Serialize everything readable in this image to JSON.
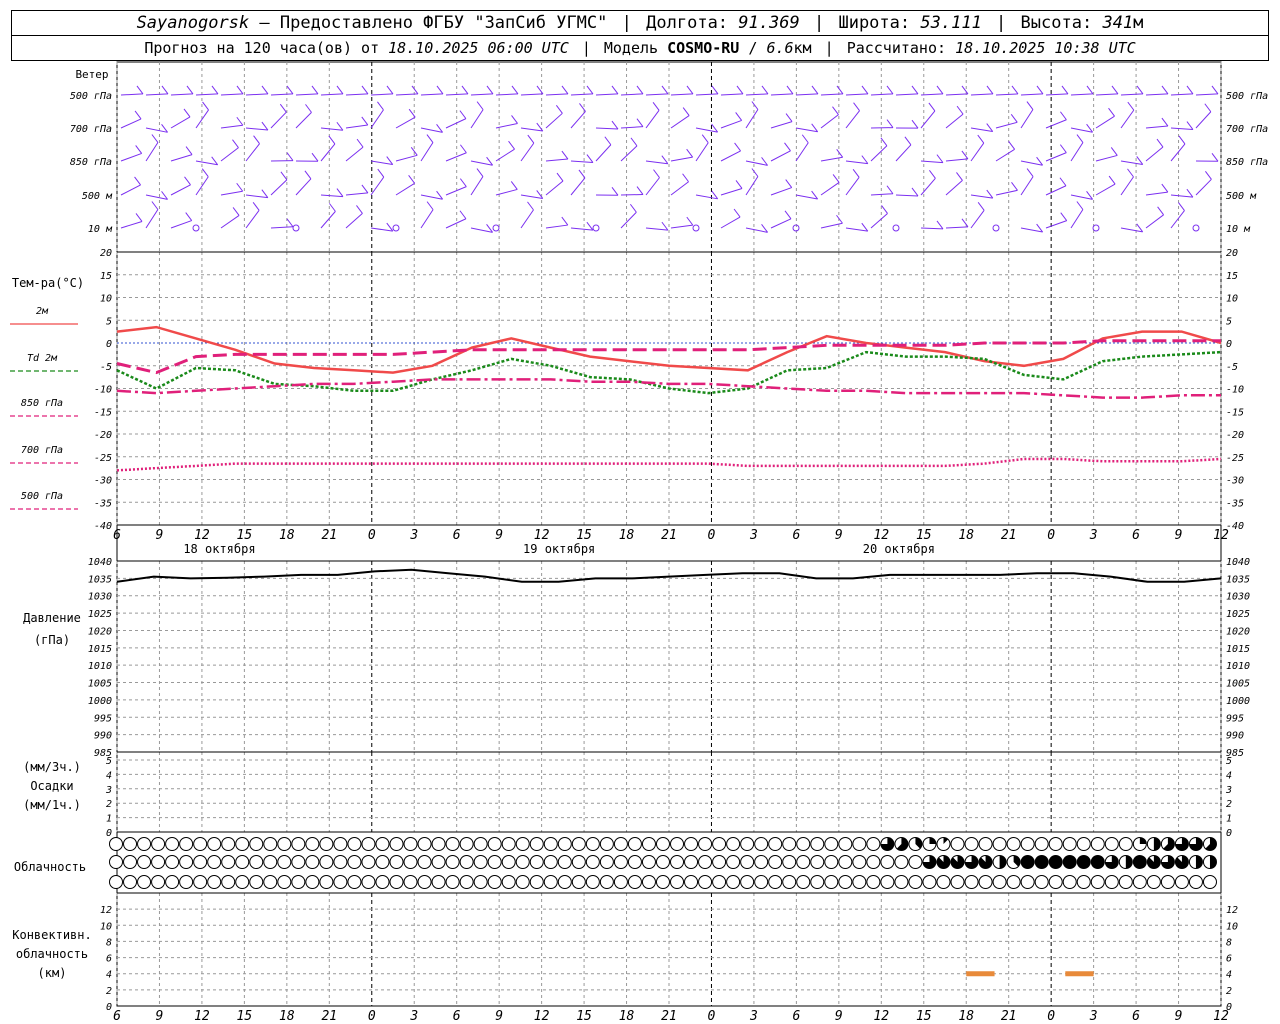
{
  "header": {
    "station": "Sayanogorsk",
    "provider": "— Предоставлено ФГБУ \"ЗапСиб УГМС\"",
    "lon_label": "Долгота:",
    "lon_value": "91.369",
    "lat_label": "Широта:",
    "lat_value": "53.111",
    "alt_label": "Высота:",
    "alt_value": "341",
    "alt_unit": "м",
    "forecast_label": "Прогноз на 120 часа(ов) от",
    "forecast_from": "18.10.2025 06:00 UTC",
    "model_label": "Модель",
    "model_name": "COSMO-RU",
    "model_res": "6.6",
    "model_res_unit": "км",
    "computed_label": "Рассчитано:",
    "computed_at": "18.10.2025 10:38 UTC"
  },
  "time_axis": {
    "tick_labels": [
      "6",
      "9",
      "12",
      "15",
      "18",
      "21",
      "0",
      "3",
      "6",
      "9",
      "12",
      "15",
      "18",
      "21",
      "0",
      "3",
      "6",
      "9",
      "12",
      "15",
      "18",
      "21",
      "0",
      "3",
      "6",
      "9",
      "12"
    ],
    "date_labels": [
      "18 октября",
      "19 октября",
      "20 октября"
    ]
  },
  "wind_panel": {
    "title": "Ветер",
    "levels": [
      "500 гПа",
      "700 гПа",
      "850 гПа",
      "500 м",
      "10 м"
    ],
    "barb_color": "#7b2ff0"
  },
  "chart_data": [
    {
      "type": "line",
      "id": "temperature",
      "ylabel": "Тем-ра(°С)",
      "ylim": [
        -40,
        20
      ],
      "y_ticks": [
        20,
        15,
        10,
        5,
        0,
        -5,
        -10,
        -15,
        -20,
        -25,
        -30,
        -35,
        -40
      ],
      "x_hours": [
        0,
        3,
        6,
        9,
        12,
        15,
        18,
        21,
        24,
        27,
        30,
        33,
        36,
        39,
        42,
        45,
        48,
        51,
        54,
        57,
        60,
        63,
        66,
        69,
        72,
        75,
        78
      ],
      "grid": true,
      "series": [
        {
          "name": "2м",
          "color": "#f04a4a",
          "style": "solid",
          "values": [
            2.5,
            3.5,
            1,
            -1.5,
            -4.5,
            -5.5,
            -6,
            -6.5,
            -5,
            -1,
            1,
            -1,
            -3,
            -4,
            -5,
            -5.5,
            -6,
            -2,
            1.5,
            0,
            -1,
            -2,
            -4,
            -5,
            -3.5,
            1,
            2.5,
            2.5,
            0
          ]
        },
        {
          "name": "Td  2м",
          "color": "#1a8a1a",
          "style": "dot",
          "values": [
            -6,
            -10,
            -5.5,
            -6,
            -9,
            -9.5,
            -10.5,
            -10.5,
            -8,
            -6,
            -3.5,
            -5,
            -7.5,
            -8,
            -10,
            -11,
            -10,
            -6,
            -5.5,
            -2,
            -3,
            -3,
            -3.5,
            -7,
            -8,
            -4,
            -3,
            -2.5,
            -2
          ]
        },
        {
          "name": "850 гПа",
          "color": "#e0207a",
          "style": "longdash",
          "values": [
            -4.5,
            -6.5,
            -3,
            -2.5,
            -2.5,
            -2.5,
            -2.5,
            -2.5,
            -2,
            -1.5,
            -1.5,
            -1.5,
            -1.5,
            -1.5,
            -1.5,
            -1.5,
            -1.5,
            -1,
            -0.5,
            -0.5,
            -0.5,
            -0.5,
            0,
            0,
            0,
            0.5,
            0.5,
            0.5,
            0.5
          ]
        },
        {
          "name": "700 гПа",
          "color": "#e0207a",
          "style": "dashdot",
          "values": [
            -10.5,
            -11,
            -10.5,
            -10,
            -9.5,
            -9,
            -9,
            -8.5,
            -8,
            -8,
            -8,
            -8,
            -8.5,
            -8.5,
            -9,
            -9,
            -9.5,
            -10,
            -10.5,
            -10.5,
            -11,
            -11,
            -11,
            -11,
            -11.5,
            -12,
            -12,
            -11.5,
            -11.5
          ]
        },
        {
          "name": "500 гПа",
          "color": "#e0207a",
          "style": "fine",
          "values": [
            -28,
            -27.5,
            -27,
            -26.5,
            -26.5,
            -26.5,
            -26.5,
            -26.5,
            -26.5,
            -26.5,
            -26.5,
            -26.5,
            -26.5,
            -26.5,
            -26.5,
            -26.5,
            -27,
            -27,
            -27,
            -27,
            -27,
            -27,
            -26.5,
            -25.5,
            -25.5,
            -26,
            -26,
            -26,
            -25.5
          ]
        }
      ]
    },
    {
      "type": "line",
      "id": "pressure",
      "ylabel": "Давление",
      "ylabel2": "(гПа)",
      "ylim": [
        985,
        1040
      ],
      "y_ticks": [
        1040,
        1035,
        1030,
        1025,
        1020,
        1015,
        1010,
        1005,
        1000,
        995,
        990,
        985
      ],
      "grid": true,
      "series": [
        {
          "name": "",
          "color": "#000000",
          "style": "solid",
          "values": [
            1034,
            1035.5,
            1035,
            1035.2,
            1035.5,
            1036,
            1036,
            1037,
            1037.5,
            1036.5,
            1035.5,
            1034,
            1034,
            1035,
            1035,
            1035.5,
            1036,
            1036.5,
            1036.5,
            1035,
            1035,
            1036,
            1036,
            1036,
            1036,
            1036.5,
            1036.5,
            1035.5,
            1034,
            1034,
            1035
          ]
        }
      ]
    },
    {
      "type": "bar",
      "id": "precipitation",
      "ylabel": "(мм/3ч.)",
      "ylabel2": "Осадки",
      "ylabel3": "(мм/1ч.)",
      "ylim": [
        0,
        5
      ],
      "y_ticks": [
        5,
        4,
        3,
        2,
        1,
        0
      ],
      "values": []
    },
    {
      "type": "table",
      "id": "cloudiness",
      "ylabel": "Облачность",
      "rows": [
        {
          "level": "high",
          "octas": [
            0,
            0,
            0,
            0,
            0,
            0,
            0,
            0,
            0,
            0,
            0,
            0,
            0,
            0,
            0,
            0,
            0,
            0,
            0,
            0,
            0,
            0,
            0,
            0,
            0,
            0,
            0,
            0,
            0,
            0,
            0,
            0,
            0,
            0,
            0,
            0,
            0,
            0,
            0,
            0,
            0,
            0,
            0,
            0,
            0,
            0,
            0,
            0,
            0,
            0,
            0,
            0,
            0,
            0,
            0,
            0,
            0,
            0,
            0,
            0,
            0,
            0,
            0,
            0,
            0,
            0,
            0,
            0,
            0,
            0,
            0,
            0,
            0,
            0,
            0,
            0,
            0,
            0,
            0,
            0,
            0,
            0,
            0,
            0,
            0,
            0,
            0,
            0,
            0,
            0,
            0,
            0,
            0,
            0,
            0,
            0,
            0,
            0,
            0,
            0,
            0,
            0,
            4,
            6,
            3,
            5,
            2,
            3,
            1,
            2,
            1,
            0,
            0,
            0,
            0,
            0,
            0,
            0,
            0,
            0,
            0,
            0,
            0,
            0,
            0,
            0,
            0,
            0,
            0,
            0,
            0,
            0,
            0,
            0,
            0,
            0,
            1,
            2,
            3,
            4,
            5,
            6,
            6,
            7,
            6,
            6,
            5
          ]
        },
        {
          "level": "mid",
          "octas": [
            0,
            0,
            0,
            0,
            0,
            0,
            0,
            0,
            0,
            0,
            0,
            0,
            0,
            0,
            0,
            0,
            0,
            0,
            0,
            0,
            0,
            0,
            0,
            0,
            0,
            0,
            0,
            0,
            0,
            0,
            0,
            0,
            0,
            0,
            0,
            0,
            0,
            0,
            0,
            0,
            0,
            0,
            0,
            0,
            0,
            0,
            0,
            0,
            0,
            0,
            0,
            0,
            0,
            0,
            0,
            0,
            0,
            0,
            0,
            0,
            0,
            0,
            0,
            0,
            0,
            0,
            0,
            0,
            0,
            0,
            0,
            0,
            0,
            0,
            0,
            0,
            0,
            0,
            0,
            0,
            0,
            0,
            0,
            0,
            0,
            0,
            0,
            0,
            0,
            0,
            0,
            0,
            0,
            0,
            0,
            0,
            0,
            0,
            0,
            0,
            0,
            0,
            6,
            7,
            7,
            7,
            4,
            6,
            6,
            7,
            7,
            4,
            3,
            5,
            8,
            8,
            8,
            8,
            8,
            8,
            8,
            8,
            8,
            8,
            8,
            6,
            4,
            5,
            8,
            6,
            7,
            4,
            6,
            7,
            8,
            4,
            4,
            4
          ]
        },
        {
          "level": "low",
          "octas": [
            0,
            0,
            0,
            0,
            0,
            0,
            0,
            0,
            0,
            0,
            0,
            0,
            0,
            0,
            0,
            0,
            0,
            0,
            0,
            0,
            0,
            0,
            0,
            0,
            0,
            0,
            0,
            0,
            0,
            0,
            0,
            0,
            0,
            0,
            0,
            0,
            0,
            0,
            0,
            0,
            0,
            0,
            0,
            0,
            0,
            0,
            0,
            0,
            0,
            0,
            0,
            0,
            0,
            0,
            0,
            0,
            0,
            0,
            0,
            0,
            0,
            0,
            0,
            0,
            0,
            0,
            0,
            0,
            0,
            0,
            0,
            0,
            0,
            0,
            0,
            0,
            0,
            0,
            0,
            0,
            0,
            0,
            0,
            0,
            0,
            0,
            0,
            0,
            0,
            0,
            0,
            0,
            0,
            0,
            0,
            0,
            0,
            0,
            0,
            0,
            0,
            0,
            0,
            0,
            0,
            0,
            0,
            0,
            0,
            0,
            0,
            0,
            0,
            0,
            0,
            0,
            0,
            0,
            0,
            0,
            0,
            0,
            0,
            0,
            0,
            0,
            0,
            0,
            0,
            0,
            0,
            0,
            0,
            0,
            0,
            0,
            0,
            0,
            0,
            0,
            0,
            0,
            0,
            0,
            0,
            0
          ]
        }
      ]
    },
    {
      "type": "bar",
      "id": "convective",
      "ylabel": "Конвективн.",
      "ylabel2": "облачность",
      "ylabel3": "(км)",
      "ylim": [
        0,
        14
      ],
      "y_ticks": [
        12,
        10,
        8,
        6,
        4,
        2,
        0
      ],
      "color": "#e88a3a",
      "segments": [
        {
          "x_start": 60,
          "x_end": 62,
          "height_km": 4
        },
        {
          "x_start": 67,
          "x_end": 69,
          "height_km": 4
        }
      ]
    }
  ]
}
